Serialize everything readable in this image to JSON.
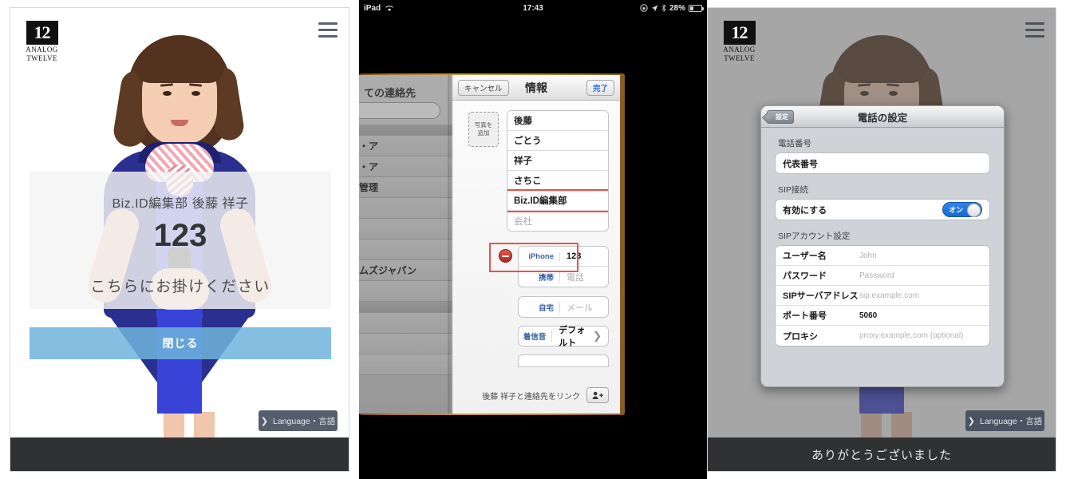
{
  "left_panel": {
    "logo": {
      "number": "12",
      "line1": "ANALOG",
      "line2": "TWELVE"
    },
    "menu_icon": "hamburger-menu-icon",
    "card": {
      "name": "Biz.ID編集部 後藤 祥子",
      "extension": "123",
      "message": "こちらにお掛けください"
    },
    "close_button": "閉じる",
    "language_button": {
      "chevron": "❯",
      "label": "Language・言語"
    }
  },
  "middle_panel": {
    "status_bar": {
      "device": "iPad",
      "wifi_icon": "wifi-icon",
      "time": "17:43",
      "rotation_lock_icon": "rotation-lock-icon",
      "location_icon": "location-arrow-icon",
      "bluetooth_icon": "bluetooth-icon",
      "battery_percent": "28%"
    },
    "left_page": {
      "title": "ての連絡先",
      "search_placeholder": "",
      "rows": [
        "",
        "・ア",
        "・ア",
        "管理",
        "",
        "",
        "",
        "ムズジャパン",
        "",
        "",
        "",
        "",
        ""
      ]
    },
    "detail_page": {
      "nav": {
        "cancel": "キャンセル",
        "title": "情報",
        "done": "完了"
      },
      "photo_add": "写真を\n追加",
      "name_fields": [
        {
          "value": "後藤",
          "placeholder": false,
          "highlighted": false
        },
        {
          "value": "ごとう",
          "placeholder": false,
          "highlighted": false
        },
        {
          "value": "祥子",
          "placeholder": false,
          "highlighted": false
        },
        {
          "value": "さちこ",
          "placeholder": false,
          "highlighted": false
        },
        {
          "value": "Biz.ID編集部",
          "placeholder": false,
          "highlighted": true
        },
        {
          "value": "会社",
          "placeholder": true,
          "highlighted": false
        }
      ],
      "phone_rows": [
        {
          "label": "iPhone",
          "value": "123",
          "placeholder": false,
          "highlighted": true
        },
        {
          "label": "携帯",
          "value": "電話",
          "placeholder": true,
          "highlighted": false
        }
      ],
      "mail_rows": [
        {
          "label": "自宅",
          "value": "メール",
          "placeholder": true
        }
      ],
      "ringtone": {
        "label": "着信音",
        "value": "デフォルト",
        "chevron": "❯"
      },
      "link_row": {
        "text": "後藤 祥子と連絡先をリンク",
        "button_icon": "add-person-icon"
      },
      "delete_icon": "minus-circle-icon"
    }
  },
  "right_panel": {
    "logo": {
      "number": "12",
      "line1": "ANALOG",
      "line2": "TWELVE"
    },
    "menu_icon": "hamburger-menu-icon",
    "language_button": {
      "chevron": "❯",
      "label": "Language・言語"
    },
    "footer_message": "ありがとうございました",
    "settings_sheet": {
      "back_button": "設定",
      "title": "電話の設定",
      "sections": [
        {
          "label": "電話番号",
          "rows": [
            {
              "label": "代表番号",
              "value": "",
              "type": "text"
            }
          ]
        },
        {
          "label": "SIP接続",
          "rows": [
            {
              "label": "有効にする",
              "value": "オン",
              "type": "toggle",
              "on": true
            }
          ]
        },
        {
          "label": "SIPアカウント設定",
          "rows": [
            {
              "label": "ユーザー名",
              "value": "John",
              "type": "placeholder"
            },
            {
              "label": "パスワード",
              "value": "Password",
              "type": "placeholder"
            },
            {
              "label": "SIPサーバアドレス",
              "value": "sip.example.com",
              "type": "placeholder"
            },
            {
              "label": "ポート番号",
              "value": "5060",
              "type": "value"
            },
            {
              "label": "プロキシ",
              "value": "proxy.example.com (optional)",
              "type": "placeholder"
            }
          ]
        }
      ]
    }
  },
  "colors": {
    "accent_blue": "#6eb4dc",
    "toggle_blue": "#2f86e8",
    "footer_dark": "#2f3133",
    "highlight_red": "#e8524a",
    "lang_button": "#3d4858"
  }
}
